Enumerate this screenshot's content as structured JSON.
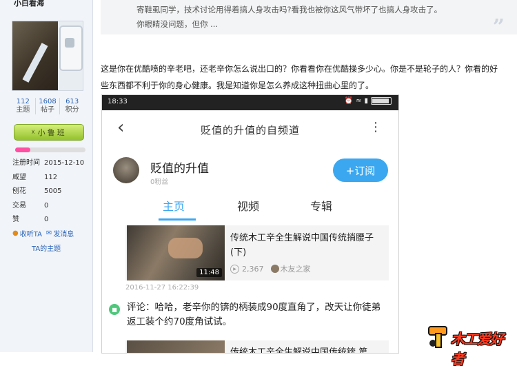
{
  "sidebar": {
    "username": "小白看海",
    "stats": [
      {
        "value": "112",
        "label": "主题"
      },
      {
        "value": "1608",
        "label": "帖子"
      },
      {
        "value": "613",
        "label": "积分"
      }
    ],
    "level_badge": "小鲁班",
    "level_progress": 0.22,
    "info": [
      {
        "key": "注册时间",
        "value": "2015-12-10"
      },
      {
        "key": "威望",
        "value": "112"
      },
      {
        "key": "刨花",
        "value": "5005"
      },
      {
        "key": "交易",
        "value": "0"
      },
      {
        "key": "赞",
        "value": "0"
      }
    ],
    "actions": {
      "follow": "收听TA",
      "message": "发消息",
      "topics": "TA的主题"
    }
  },
  "post": {
    "quote_lines": [
      "寄鞋虱同学，技术讨论用得着搞人身攻击吗?看我也被你这风气带坏了也搞人身攻击了。",
      "你眼睛没问题，但你 ..."
    ],
    "paragraph_1": "这是你在优酷喷的辛老吧，还老辛你怎么说出口的？你看看你在优酷操多少心。你是不是轮子的人？你看的好",
    "paragraph_2": "些东西都不利于你的身心健康。我是知道你是怎么养成这种扭曲心里的了。"
  },
  "phone": {
    "time": "18:33",
    "title": "贬值的升值的自频道",
    "channel_name": "贬值的升值",
    "subscribers": "0粉丝",
    "subscribe_label": "+订阅",
    "tabs": [
      "主页",
      "视频",
      "专辑"
    ],
    "video": {
      "title": "传统木工辛全生解说中国传统捎腰子(下)",
      "duration": "11:48",
      "views": "2,367",
      "author": "木友之家",
      "date": "2016-11-27 16:22:39"
    },
    "comment": "评论：哈哈，老辛你的锛的柄装成90度直角了，改天让你徒弟返工装个约70度角试试。",
    "video2_title": "传统木工辛全生解说中国传统锛 第"
  },
  "watermark": "木工爱好者"
}
